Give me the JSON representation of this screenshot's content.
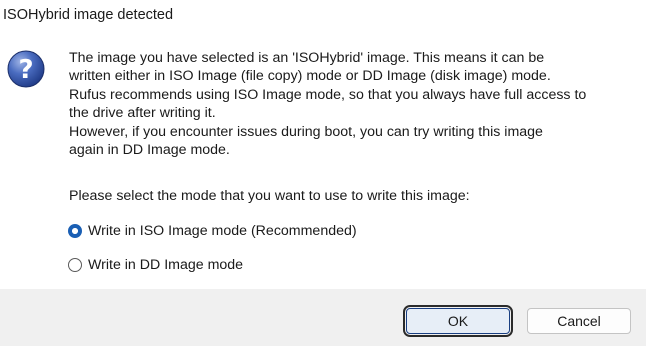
{
  "dialog": {
    "title": "ISOHybrid image detected",
    "icon": "question-icon",
    "message_lines": [
      "The image you have selected is an 'ISOHybrid' image. This means it can be",
      "written either in ISO Image (file copy) mode or DD Image (disk image) mode.",
      "Rufus recommends using ISO Image mode, so that you always have full access to",
      "the drive after writing it.",
      "However, if you encounter issues during boot, you can try writing this image",
      "again in DD Image mode."
    ],
    "prompt": "Please select the mode that you want to use to write this image:",
    "options": [
      {
        "label": "Write in ISO Image mode (Recommended)",
        "selected": true
      },
      {
        "label": "Write in DD Image mode",
        "selected": false
      }
    ],
    "buttons": {
      "ok": "OK",
      "cancel": "Cancel"
    },
    "colors": {
      "accent": "#1a5fb4",
      "footer_bg": "#f0f0f0",
      "icon_blue": "#3a5fb0"
    }
  }
}
